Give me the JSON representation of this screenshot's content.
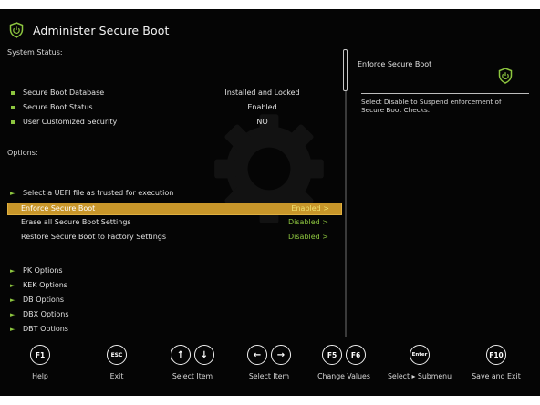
{
  "header": {
    "title": "Administer Secure Boot",
    "icon": "shield-power-icon"
  },
  "system_status": {
    "label": "System Status:",
    "items": [
      {
        "label": "Secure Boot Database",
        "value": "Installed and Locked"
      },
      {
        "label": "Secure Boot Status",
        "value": "Enabled"
      },
      {
        "label": "User Customized Security",
        "value": "NO"
      }
    ]
  },
  "options": {
    "label": "Options:",
    "select_uefi": "Select a UEFI file as trusted for execution",
    "settings": [
      {
        "label": "Enforce Secure Boot",
        "value": "Enabled >",
        "selected": true
      },
      {
        "label": "Erase all Secure Boot Settings",
        "value": "Disabled >"
      },
      {
        "label": "Restore Secure Boot to Factory Settings",
        "value": "Disabled >"
      }
    ],
    "submenus": [
      "PK Options",
      "KEK Options",
      "DB Options",
      "DBX Options",
      "DBT Options"
    ]
  },
  "help": {
    "title": "Enforce Secure Boot",
    "description": "Select Disable to Suspend enforcement of Secure Boot Checks."
  },
  "footer": [
    {
      "keys": [
        "F1"
      ],
      "label": "Help"
    },
    {
      "keys": [
        "ESC"
      ],
      "label": "Exit"
    },
    {
      "keys": [
        "↑",
        "↓"
      ],
      "label": "Select Item"
    },
    {
      "keys": [
        "←",
        "→"
      ],
      "label": "Select Item"
    },
    {
      "keys": [
        "F5",
        "F6"
      ],
      "label": "Change Values"
    },
    {
      "keys": [
        "Enter"
      ],
      "label": "Select ▸ Submenu"
    },
    {
      "keys": [
        "F10"
      ],
      "label": "Save and Exit"
    }
  ],
  "colors": {
    "accent": "#8dc63f",
    "highlight": "#c8962a",
    "background": "#050505"
  }
}
